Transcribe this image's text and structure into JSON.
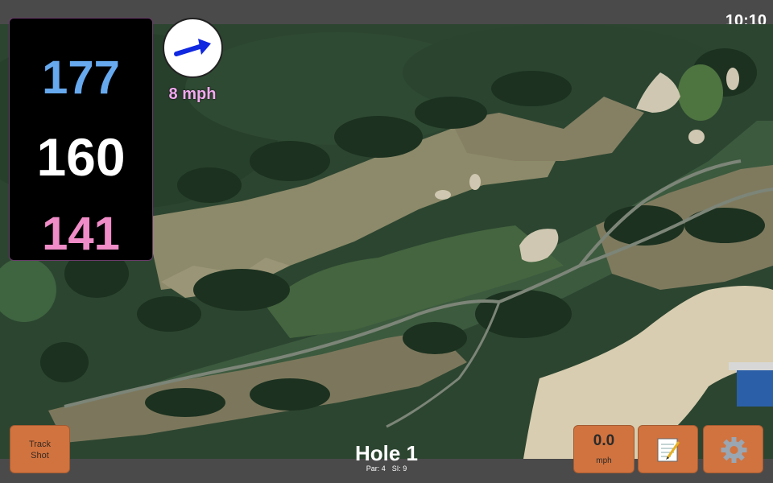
{
  "status_bar": {
    "time": "10:10"
  },
  "distances": {
    "back": "177",
    "middle": "160",
    "front": "141"
  },
  "wind": {
    "speed_label": "8 mph",
    "icon": "wind-arrow-icon"
  },
  "hole": {
    "title": "Hole 1",
    "par": "Par: 4",
    "stroke_index": "SI: 9"
  },
  "buttons": {
    "track_shot_line1": "Track",
    "track_shot_line2": "Shot",
    "speed_value": "0.0",
    "speed_unit": "mph",
    "notes_icon": "notepad-icon",
    "settings_icon": "gear-icon"
  },
  "colors": {
    "back": "#66a9ee",
    "middle": "#ffffff",
    "front": "#f08cc8",
    "wind_arrow": "#1028e0",
    "button": "#d0733f"
  }
}
